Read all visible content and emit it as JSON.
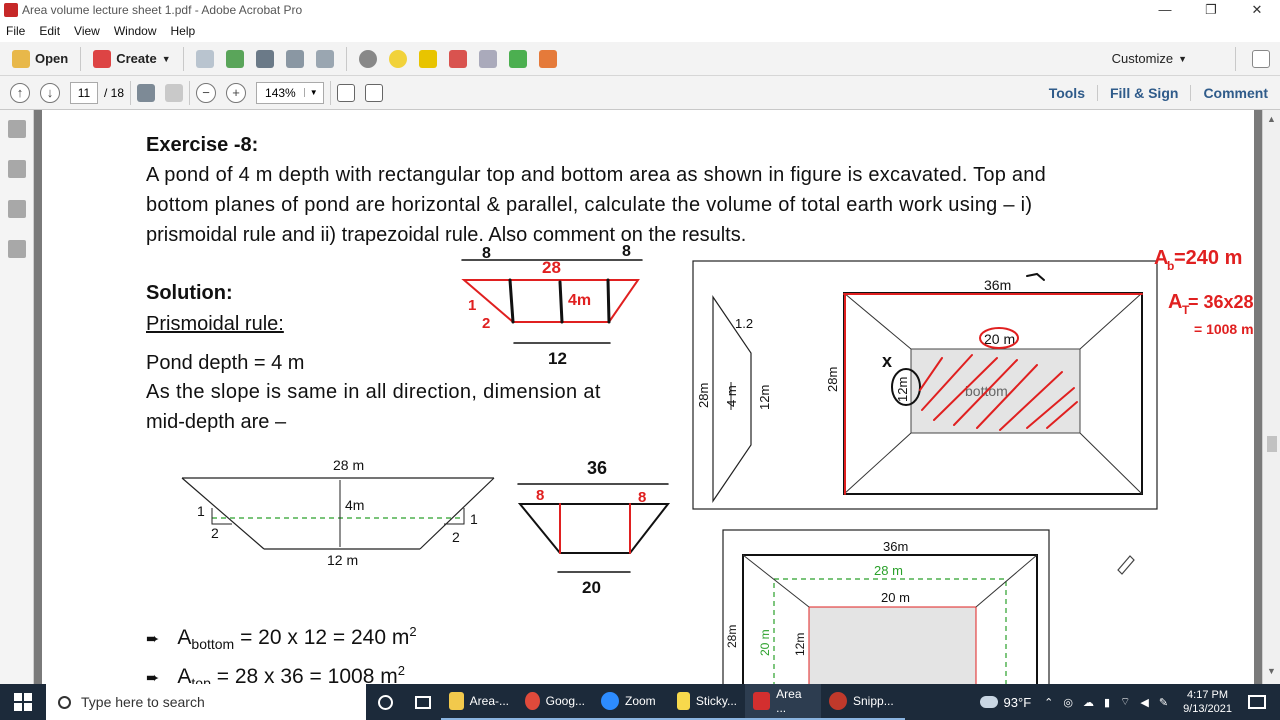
{
  "window": {
    "title": "Area volume lecture sheet 1.pdf - Adobe Acrobat Pro",
    "minimize_glyph": "—",
    "restore_glyph": "❐",
    "close_glyph": "✕"
  },
  "menu": [
    "File",
    "Edit",
    "View",
    "Window",
    "Help"
  ],
  "toolbar": {
    "open_label": "Open",
    "create_label": "Create",
    "customize_label": "Customize"
  },
  "nav": {
    "page_value": "11",
    "page_total": "/ 18",
    "zoom_value": "143%",
    "tools_label": "Tools",
    "fillsign_label": "Fill & Sign",
    "comment_label": "Comment"
  },
  "doc": {
    "heading": "Exercise -8:",
    "para_line1": "A pond of 4 m depth with rectangular top and bottom area as shown in figure is excavated. Top and",
    "para_line2": "bottom planes of pond are horizontal & parallel, calculate the volume of total earth work using – i)",
    "para_line3": "prismoidal rule and ii) trapezoidal rule. Also comment on the results.",
    "solution": "Solution:",
    "rule": "Prismoidal rule:",
    "depth": "Pond depth = 4 m",
    "slope_line1": "As the slope is same in all direction, dimension at",
    "slope_line2": "mid-depth are –",
    "bullet_glyph": "➨",
    "area_bottom_sym": "A",
    "area_bottom_sub": "bottom",
    "area_bottom_eq": "= 20 x 12 = 240 m",
    "area_top_sym": "A",
    "area_top_sub": "top",
    "area_top_eq": "= 28 x 36 = 1008 m",
    "sup2": "2",
    "fig_top_width": "28 m",
    "fig_depth": "4m",
    "fig_bottom_width": "12 m",
    "fig_slope_v": "1",
    "fig_slope_h": "2",
    "plan_top": "36m",
    "plan_side": "28m",
    "plan_inner_top": "20 m",
    "plan_inner_side": "12m",
    "plan_bottom_label": "bottom",
    "side_slope": "1.2",
    "side_28": "28m",
    "side_4": "4 m",
    "side_12": "12m",
    "plan2_top": "36m",
    "plan2_mid": "28 m",
    "plan2_inner": "20 m",
    "plan2_side": "28m",
    "plan2_mid_side": "20 m",
    "plan2_inner_side": "12m"
  },
  "ink": {
    "sk1_8a": "8",
    "sk1_28": "28",
    "sk1_8b": "8",
    "sk1_4m": "4m",
    "sk1_12": "12",
    "sk1_1": "1",
    "sk1_2": "2",
    "sk2_36": "36",
    "sk2_8a": "8",
    "sk2_8b": "8",
    "sk2_20": "20",
    "ab_eq": "A",
    "ab_sub": "b",
    "ab_val": "=240 m",
    "at_eq": "A",
    "at_sub": "T",
    "at_val": "= 36x28",
    "at_res": "= 1008 m",
    "x_mark": "x"
  },
  "taskbar": {
    "search_placeholder": "Type here to search",
    "apps": [
      "Area-...",
      "Goog...",
      "Zoom",
      "Sticky...",
      "Area ...",
      "Snipp..."
    ],
    "weather": "93°F",
    "time": "4:17 PM",
    "date": "9/13/2021"
  },
  "colors": {
    "accent_blue": "#2f5b8a",
    "ink_red": "#e02020",
    "ink_black": "#111111",
    "guide_green": "#2aa02a",
    "taskbar": "#1c2a3a"
  }
}
